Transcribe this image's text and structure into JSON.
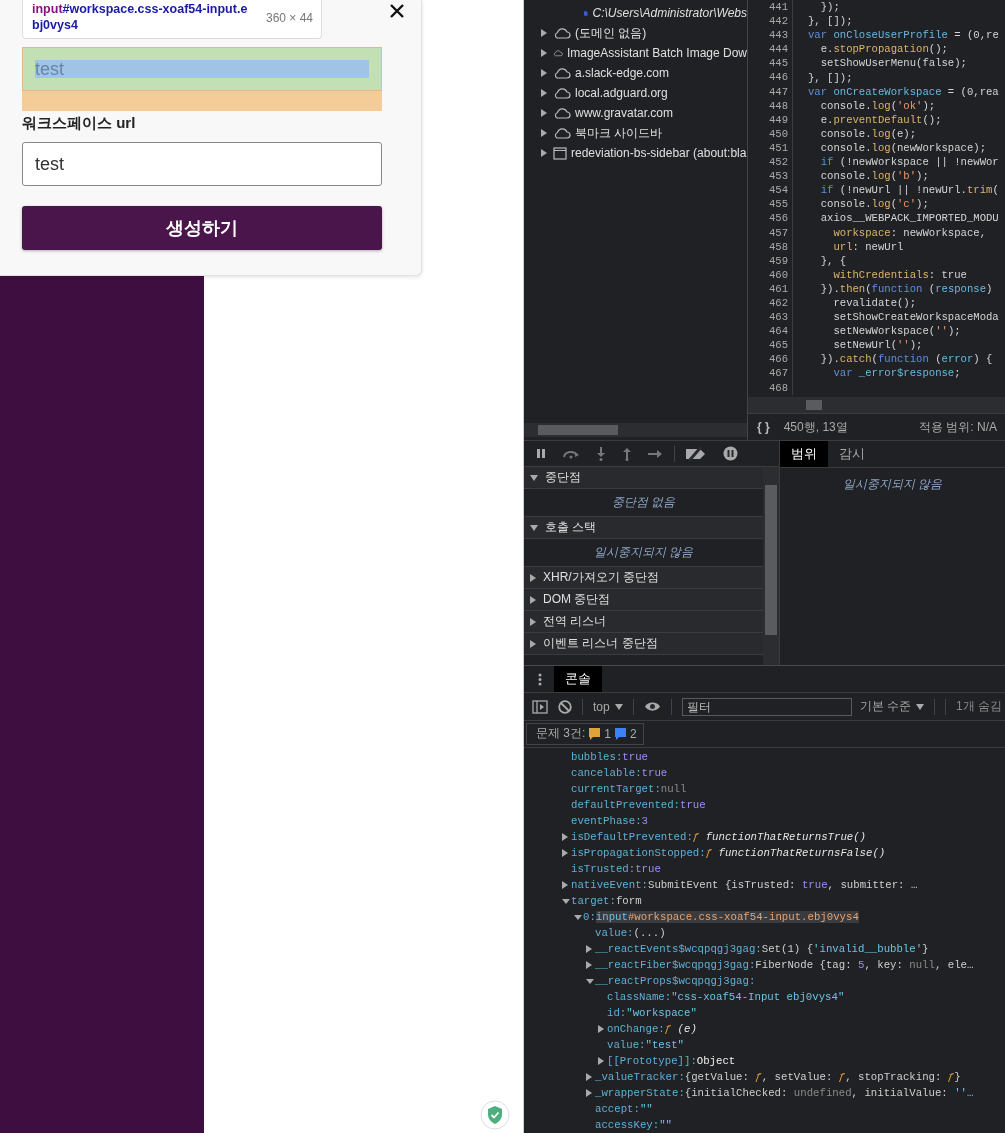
{
  "page": {
    "modal": {
      "inspect_tooltip": {
        "tag": "input",
        "selector": "#workspace.css-xoaf54-input.ebj0vys4",
        "size": "360 × 44"
      },
      "workspace_input": {
        "value": "test",
        "highlighted": true
      },
      "url_label": "워크스페이스 url",
      "url_input": {
        "value": "test",
        "highlighted": false
      },
      "submit_button": "생성하기"
    }
  },
  "devtools": {
    "sources_tree": [
      {
        "kind": "file",
        "label": "C:\\Users\\Administrator\\Webs"
      },
      {
        "kind": "domain",
        "label": "(도메인 없음)",
        "expanded": false
      },
      {
        "kind": "domain",
        "label": "ImageAssistant Batch Image Dow",
        "expanded": false
      },
      {
        "kind": "domain",
        "label": "a.slack-edge.com",
        "expanded": false
      },
      {
        "kind": "domain",
        "label": "local.adguard.org",
        "expanded": false
      },
      {
        "kind": "domain",
        "label": "www.gravatar.com",
        "expanded": false
      },
      {
        "kind": "domain",
        "label": "북마크 사이드바",
        "expanded": false
      },
      {
        "kind": "frame",
        "label": "redeviation-bs-sidebar (about:bla",
        "expanded": false
      }
    ],
    "code_lines": [
      {
        "number": "441",
        "tokens": [
          {
            "kind": "plain",
            "text": "  });"
          }
        ]
      },
      {
        "number": "442",
        "tokens": [
          {
            "kind": "plain",
            "text": "}, []);"
          }
        ]
      },
      {
        "number": "443",
        "tokens": [
          {
            "kind": "keyword",
            "text": "var "
          },
          {
            "kind": "name",
            "text": "onCloseUserProfile"
          },
          {
            "kind": "plain",
            "text": " = (0,re"
          }
        ]
      },
      {
        "number": "444",
        "tokens": [
          {
            "kind": "plain",
            "text": "  e."
          },
          {
            "kind": "method",
            "text": "stopPropagation"
          },
          {
            "kind": "plain",
            "text": "();"
          }
        ]
      },
      {
        "number": "445",
        "tokens": [
          {
            "kind": "plain",
            "text": "  setShowUserMenu(false);"
          }
        ]
      },
      {
        "number": "446",
        "tokens": [
          {
            "kind": "plain",
            "text": "}, []);"
          }
        ]
      },
      {
        "number": "447",
        "tokens": [
          {
            "kind": "keyword",
            "text": "var "
          },
          {
            "kind": "name",
            "text": "onCreateWorkspace"
          },
          {
            "kind": "plain",
            "text": " = (0,rea"
          }
        ]
      },
      {
        "number": "448",
        "tokens": [
          {
            "kind": "plain",
            "text": "  console."
          },
          {
            "kind": "method",
            "text": "log"
          },
          {
            "kind": "plain",
            "text": "("
          },
          {
            "kind": "string",
            "text": "'ok'"
          },
          {
            "kind": "plain",
            "text": ");"
          }
        ]
      },
      {
        "number": "449",
        "tokens": [
          {
            "kind": "plain",
            "text": "  e."
          },
          {
            "kind": "method",
            "text": "preventDefault"
          },
          {
            "kind": "plain",
            "text": "();"
          }
        ]
      },
      {
        "number": "450",
        "tokens": [
          {
            "kind": "plain",
            "text": "  console."
          },
          {
            "kind": "method",
            "text": "log"
          },
          {
            "kind": "plain",
            "text": "(e);"
          }
        ]
      },
      {
        "number": "451",
        "tokens": [
          {
            "kind": "plain",
            "text": "  console."
          },
          {
            "kind": "method",
            "text": "log"
          },
          {
            "kind": "plain",
            "text": "(newWorkspace);"
          }
        ]
      },
      {
        "number": "452",
        "tokens": [
          {
            "kind": "keyword",
            "text": "  if"
          },
          {
            "kind": "plain",
            "text": " (!newWorkspace || !newWor"
          }
        ]
      },
      {
        "number": "453",
        "tokens": [
          {
            "kind": "plain",
            "text": "  console."
          },
          {
            "kind": "method",
            "text": "log"
          },
          {
            "kind": "plain",
            "text": "("
          },
          {
            "kind": "string",
            "text": "'b'"
          },
          {
            "kind": "plain",
            "text": ");"
          }
        ]
      },
      {
        "number": "454",
        "tokens": [
          {
            "kind": "keyword",
            "text": "  if"
          },
          {
            "kind": "plain",
            "text": " (!newUrl || !newUrl."
          },
          {
            "kind": "method",
            "text": "trim"
          },
          {
            "kind": "plain",
            "text": "("
          }
        ]
      },
      {
        "number": "455",
        "tokens": [
          {
            "kind": "plain",
            "text": "  console."
          },
          {
            "kind": "method",
            "text": "log"
          },
          {
            "kind": "plain",
            "text": "("
          },
          {
            "kind": "string",
            "text": "'c'"
          },
          {
            "kind": "plain",
            "text": ");"
          }
        ]
      },
      {
        "number": "456",
        "tokens": [
          {
            "kind": "plain",
            "text": "  axios__WEBPACK_IMPORTED_MODU"
          }
        ]
      },
      {
        "number": "457",
        "tokens": [
          {
            "kind": "method",
            "text": "    workspace"
          },
          {
            "kind": "plain",
            "text": ": newWorkspace,"
          }
        ]
      },
      {
        "number": "458",
        "tokens": [
          {
            "kind": "method",
            "text": "    url"
          },
          {
            "kind": "plain",
            "text": ": newUrl"
          }
        ]
      },
      {
        "number": "459",
        "tokens": [
          {
            "kind": "plain",
            "text": "  }, {"
          }
        ]
      },
      {
        "number": "460",
        "tokens": [
          {
            "kind": "method",
            "text": "    withCredentials"
          },
          {
            "kind": "plain",
            "text": ": true"
          }
        ]
      },
      {
        "number": "461",
        "tokens": [
          {
            "kind": "plain",
            "text": "  })."
          },
          {
            "kind": "method",
            "text": "then"
          },
          {
            "kind": "plain",
            "text": "("
          },
          {
            "kind": "keyword",
            "text": "function"
          },
          {
            "kind": "plain",
            "text": " ("
          },
          {
            "kind": "name",
            "text": "response"
          },
          {
            "kind": "plain",
            "text": ")"
          }
        ]
      },
      {
        "number": "462",
        "tokens": [
          {
            "kind": "plain",
            "text": "    revalidate();"
          }
        ]
      },
      {
        "number": "463",
        "tokens": [
          {
            "kind": "plain",
            "text": "    setShowCreateWorkspaceModa"
          }
        ]
      },
      {
        "number": "464",
        "tokens": [
          {
            "kind": "plain",
            "text": "    setNewWorkspace("
          },
          {
            "kind": "string",
            "text": "''"
          },
          {
            "kind": "plain",
            "text": ");"
          }
        ]
      },
      {
        "number": "465",
        "tokens": [
          {
            "kind": "plain",
            "text": "    setNewUrl("
          },
          {
            "kind": "string",
            "text": "''"
          },
          {
            "kind": "plain",
            "text": ");"
          }
        ]
      },
      {
        "number": "466",
        "tokens": [
          {
            "kind": "plain",
            "text": "  })."
          },
          {
            "kind": "method",
            "text": "catch"
          },
          {
            "kind": "plain",
            "text": "("
          },
          {
            "kind": "keyword",
            "text": "function"
          },
          {
            "kind": "plain",
            "text": " ("
          },
          {
            "kind": "name",
            "text": "error"
          },
          {
            "kind": "plain",
            "text": ") {"
          }
        ]
      },
      {
        "number": "467",
        "tokens": [
          {
            "kind": "keyword",
            "text": "    var "
          },
          {
            "kind": "name",
            "text": "_error$response"
          },
          {
            "kind": "plain",
            "text": ";"
          }
        ]
      },
      {
        "number": "468"
      }
    ],
    "status_bar": {
      "format_button": "{ }",
      "position": "450행, 13열",
      "coverage": "적용 범위: N/A"
    },
    "debugger_sections": [
      {
        "title": "중단점",
        "expanded": true,
        "message": "중단점 없음"
      },
      {
        "title": "호출 스택",
        "expanded": true,
        "message": "일시중지되지 않음"
      },
      {
        "title": "XHR/가져오기 중단점",
        "expanded": false
      },
      {
        "title": "DOM 중단점",
        "expanded": false
      },
      {
        "title": "전역 리스너",
        "expanded": false
      },
      {
        "title": "이벤트 리스너 중단점",
        "expanded": false
      }
    ],
    "scope_tabs": [
      {
        "label": "범위",
        "selected": true
      },
      {
        "label": "감시",
        "selected": false
      }
    ],
    "scope_message": "일시중지되지 않음",
    "drawer_tabs": [
      {
        "label": "콘솔",
        "selected": true
      }
    ],
    "console": {
      "context": "top",
      "filter_placeholder": "필터",
      "level": "기본 수준",
      "hidden": "1개 숨김",
      "issues": {
        "label": "문제 3건:",
        "counts": [
          {
            "kind": "warning",
            "count": "1"
          },
          {
            "kind": "info",
            "count": "2"
          }
        ]
      },
      "rows": [
        {
          "key": "bubbles:",
          "value": [
            {
              "kind": "literal",
              "text": "true"
            }
          ]
        },
        {
          "key": "cancelable:",
          "value": [
            {
              "kind": "literal",
              "text": "true"
            }
          ]
        },
        {
          "key": "currentTarget:",
          "value": [
            {
              "kind": "null",
              "text": "null"
            }
          ]
        },
        {
          "key": "defaultPrevented:",
          "value": [
            {
              "kind": "literal",
              "text": "true"
            }
          ]
        },
        {
          "key": "eventPhase:",
          "value": [
            {
              "kind": "literal",
              "text": "3"
            }
          ]
        },
        {
          "key": "isDefaultPrevented:",
          "expanded": false,
          "value": [
            {
              "kind": "fn",
              "text": "ƒ"
            },
            {
              "kind": "italic",
              "text": " functionThatReturnsTrue()"
            }
          ]
        },
        {
          "key": "isPropagationStopped:",
          "expanded": false,
          "value": [
            {
              "kind": "fn",
              "text": "ƒ"
            },
            {
              "kind": "italic",
              "text": " functionThatReturnsFalse()"
            }
          ]
        },
        {
          "key": "isTrusted:",
          "value": [
            {
              "kind": "literal",
              "text": "true"
            }
          ]
        },
        {
          "key": "nativeEvent:",
          "expanded": false,
          "value": [
            {
              "kind": "plain",
              "text": "SubmitEvent {isTrusted: "
            },
            {
              "kind": "literal",
              "text": "true"
            },
            {
              "kind": "plain",
              "text": ", submitter: …"
            }
          ]
        },
        {
          "key": "target:",
          "expanded": true,
          "value": [
            {
              "kind": "plain",
              "text": "form"
            }
          ],
          "children": [
            {
              "key": "0:",
              "expanded": true,
              "value": [
                {
                  "kind": "tag",
                  "text": "input"
                },
                {
                  "kind": "selector",
                  "text": "#workspace.css-xoaf54-input.ebj0vys4"
                }
              ],
              "children": [
                {
                  "key": "value:",
                  "value": [
                    {
                      "kind": "plain",
                      "text": "(...)"
                    }
                  ]
                },
                {
                  "key": "__reactEvents$wcqpqgj3gag:",
                  "expanded": false,
                  "value": [
                    {
                      "kind": "plain",
                      "text": "Set(1) {"
                    },
                    {
                      "kind": "string",
                      "text": "'invalid__bubble'"
                    },
                    {
                      "kind": "plain",
                      "text": "}"
                    }
                  ]
                },
                {
                  "key": "__reactFiber$wcqpqgj3gag:",
                  "expanded": false,
                  "value": [
                    {
                      "kind": "plain",
                      "text": "FiberNode {tag: "
                    },
                    {
                      "kind": "literal",
                      "text": "5"
                    },
                    {
                      "kind": "plain",
                      "text": ", key: "
                    },
                    {
                      "kind": "null",
                      "text": "null"
                    },
                    {
                      "kind": "plain",
                      "text": ", ele…"
                    }
                  ]
                },
                {
                  "key": "__reactProps$wcqpqgj3gag:",
                  "expanded": true,
                  "children": [
                    {
                      "key": "className:",
                      "value": [
                        {
                          "kind": "string",
                          "text": "\"css-xoaf54-Input ebj0vys4\""
                        }
                      ]
                    },
                    {
                      "key": "id:",
                      "value": [
                        {
                          "kind": "string",
                          "text": "\"workspace\""
                        }
                      ]
                    },
                    {
                      "key": "onChange:",
                      "expanded": false,
                      "value": [
                        {
                          "kind": "fn",
                          "text": "ƒ"
                        },
                        {
                          "kind": "italic",
                          "text": " (e)"
                        }
                      ]
                    },
                    {
                      "key": "value:",
                      "value": [
                        {
                          "kind": "string",
                          "text": "\"test\""
                        }
                      ]
                    },
                    {
                      "key": "[[Prototype]]:",
                      "expanded": false,
                      "value": [
                        {
                          "kind": "object",
                          "text": "Object"
                        }
                      ]
                    }
                  ]
                },
                {
                  "key": "_valueTracker:",
                  "expanded": false,
                  "value": [
                    {
                      "kind": "plain",
                      "text": "{getValue: "
                    },
                    {
                      "kind": "fn",
                      "text": "ƒ"
                    },
                    {
                      "kind": "plain",
                      "text": ", setValue: "
                    },
                    {
                      "kind": "fn",
                      "text": "ƒ"
                    },
                    {
                      "kind": "plain",
                      "text": ", stopTracking: "
                    },
                    {
                      "kind": "fn",
                      "text": "ƒ"
                    },
                    {
                      "kind": "plain",
                      "text": "}"
                    }
                  ]
                },
                {
                  "key": "_wrapperState:",
                  "expanded": false,
                  "value": [
                    {
                      "kind": "plain",
                      "text": "{initialChecked: "
                    },
                    {
                      "kind": "null",
                      "text": "undefined"
                    },
                    {
                      "kind": "plain",
                      "text": ", initialValue: "
                    },
                    {
                      "kind": "string",
                      "text": "''…"
                    }
                  ]
                },
                {
                  "key": "accept:",
                  "value": [
                    {
                      "kind": "string",
                      "text": "\"\""
                    }
                  ]
                },
                {
                  "key": "accessKey:",
                  "value": [
                    {
                      "kind": "string",
                      "text": "\"\""
                    }
                  ]
                }
              ]
            }
          ]
        }
      ]
    }
  }
}
